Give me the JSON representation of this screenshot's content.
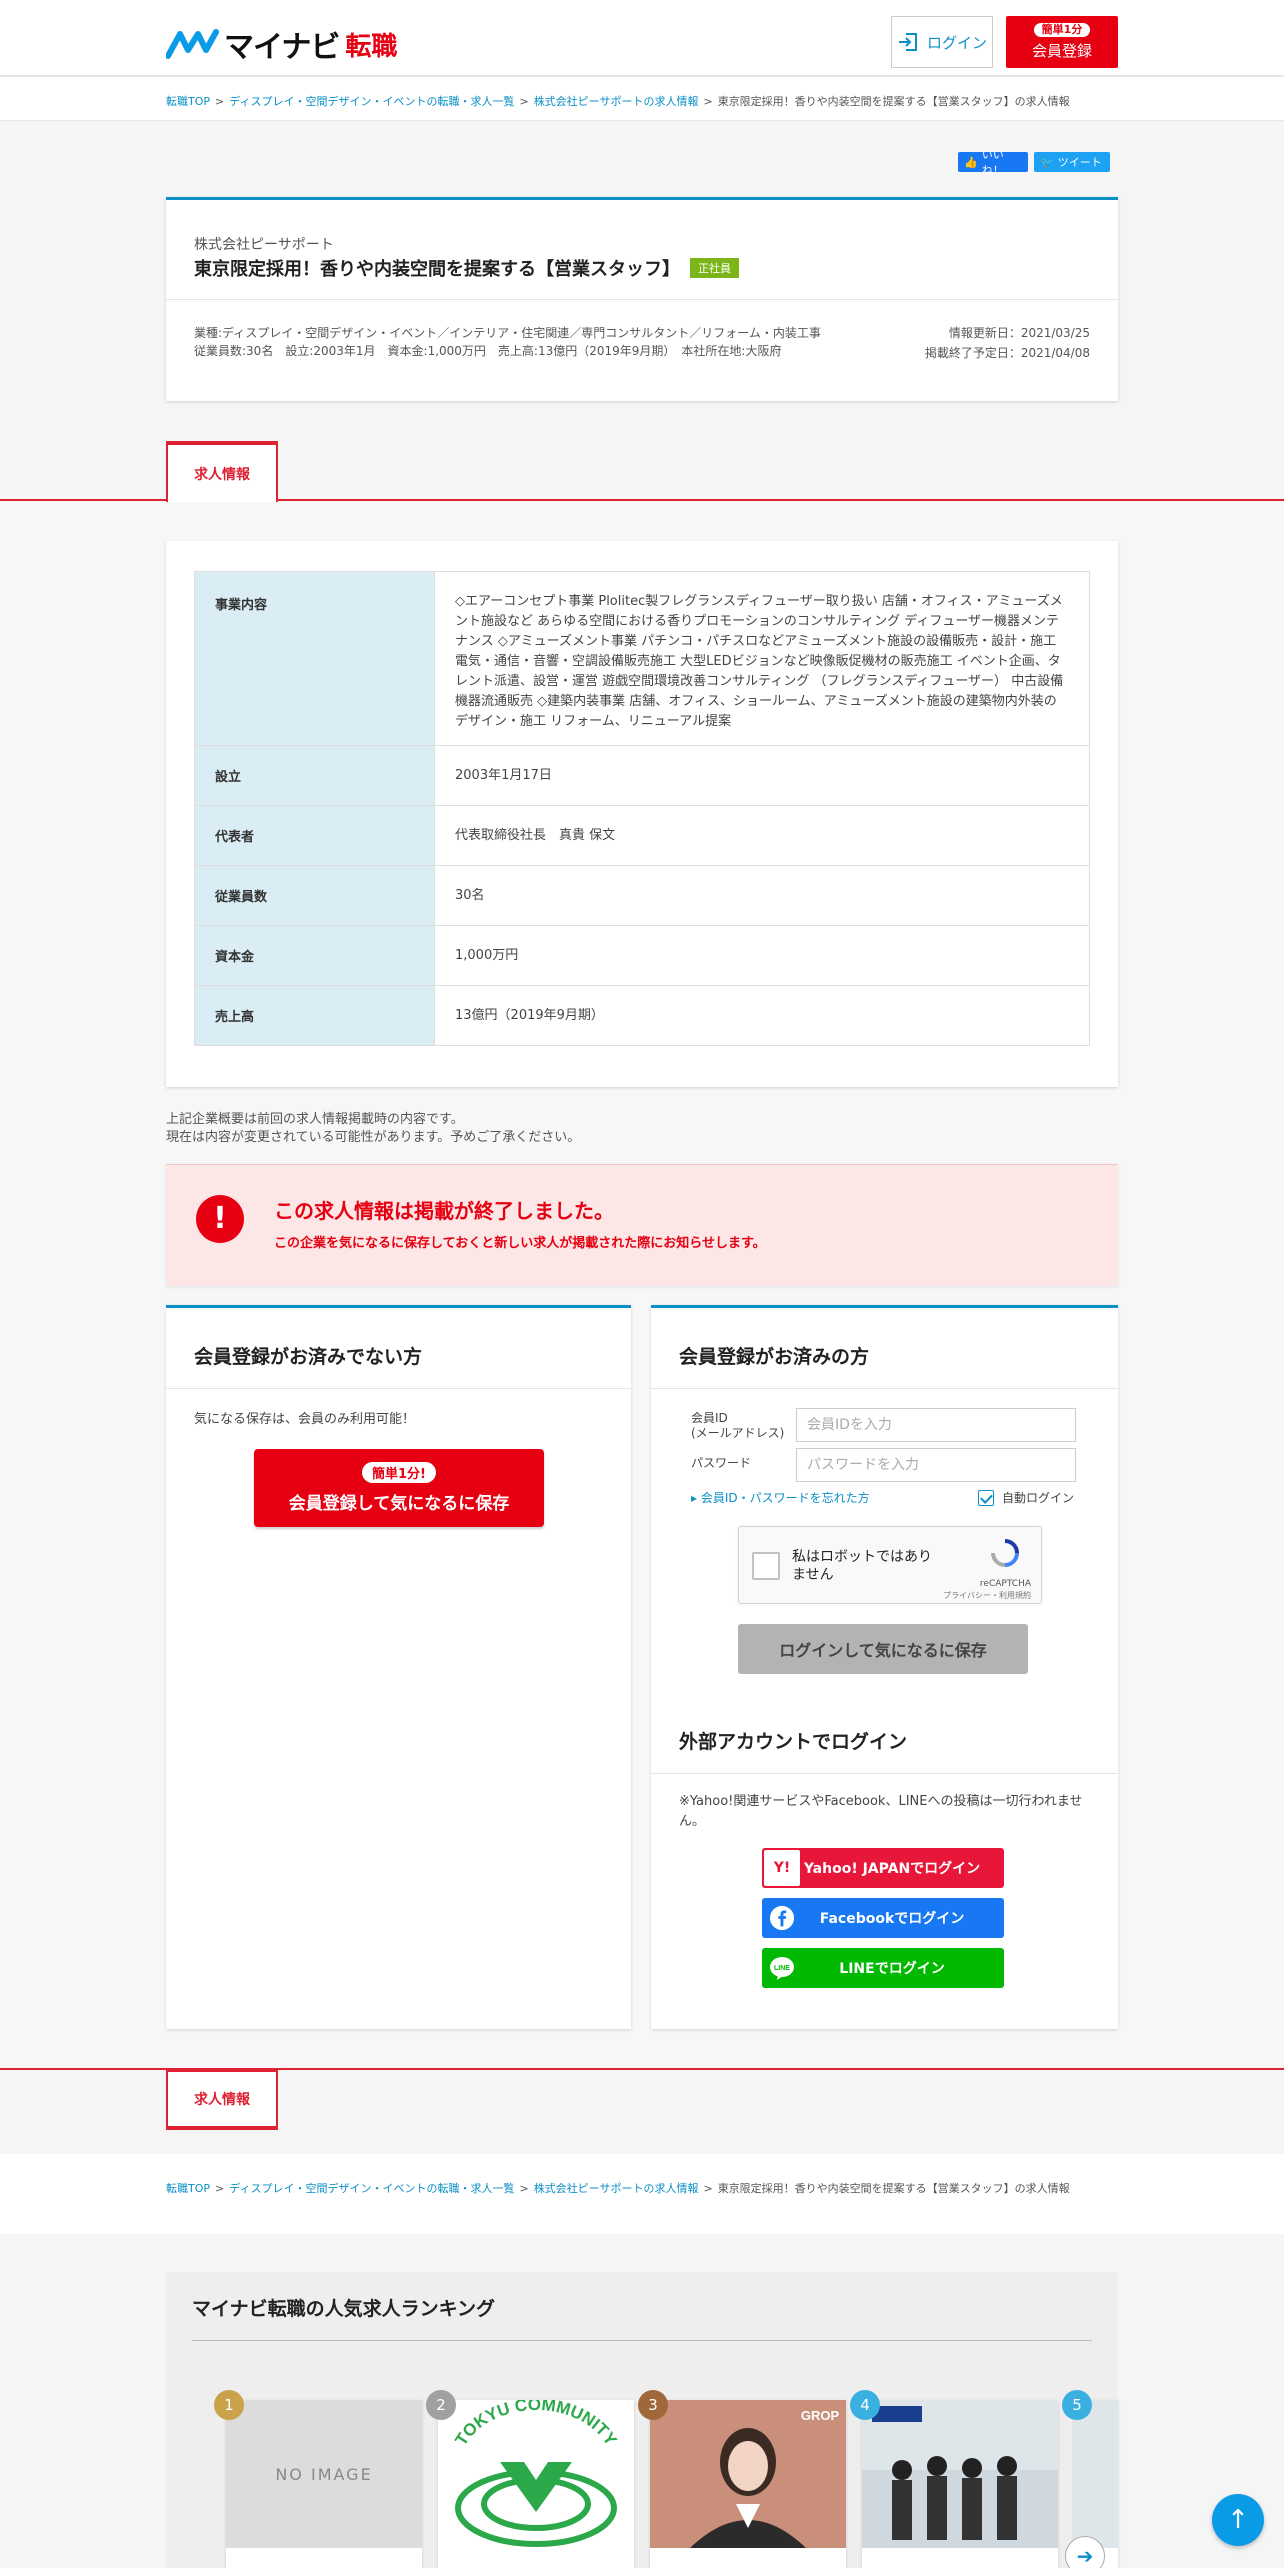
{
  "header": {
    "logo_text": "マイナビ",
    "logo_sub": "転職",
    "login_label": "ログイン",
    "register_pill": "簡単1分",
    "register_label": "会員登録"
  },
  "breadcrumb": {
    "items": [
      "転職TOP",
      "ディスプレイ・空間デザイン・イベントの転職・求人一覧",
      "株式会社ピーサポートの求人情報",
      "東京限定採用！香りや内装空間を提案する【営業スタッフ】の求人情報"
    ],
    "separator": ">"
  },
  "social": {
    "like": "いいね！",
    "tweet": "ツイート"
  },
  "job": {
    "company": "株式会社ピーサポート",
    "title": "東京限定採用！香りや内装空間を提案する【営業スタッフ】",
    "badge": "正社員",
    "industry": "業種:ディスプレイ・空間デザイン・イベント／インテリア・住宅関連／専門コンサルタント／リフォーム・内装工事",
    "summary": "従業員数:30名　設立:2003年1月　資本金:1,000万円　売上高:13億円（2019年9月期）　本社所在地:大阪府",
    "updated": "情報更新日：2021/03/25",
    "end_date": "掲載終了予定日：2021/04/08"
  },
  "tab_label": "求人情報",
  "company_info": {
    "rows": [
      {
        "label": "事業内容",
        "value": "◇エアーコンセプト事業 Plolitec製フレグランスディフューザー取り扱い 店舗・オフィス・アミューズメント施設など あらゆる空間における香りプロモーションのコンサルティング ディフューザー機器メンテナンス ◇アミューズメント事業 パチンコ・パチスロなどアミューズメント施設の設備販売・設計・施工 電気・通信・音響・空調設備販売施工 大型LEDビジョンなど映像販促機材の販売施工 イベント企画、タレント派遣、設営・運営 遊戯空間環境改善コンサルティング （フレグランスディフューザー） 中古設備機器流通販売 ◇建築内装事業 店舗、オフィス、ショールーム、アミューズメント施設の建築物内外装のデザイン・施工 リフォーム、リニューアル提案"
      },
      {
        "label": "設立",
        "value": "2003年1月17日"
      },
      {
        "label": "代表者",
        "value": "代表取締役社長　真貴 保文"
      },
      {
        "label": "従業員数",
        "value": "30名"
      },
      {
        "label": "資本金",
        "value": "1,000万円"
      },
      {
        "label": "売上高",
        "value": "13億円（2019年9月期）"
      }
    ]
  },
  "notes": {
    "line1": "上記企業概要は前回の求人情報掲載時の内容です。",
    "line2": "現在は内容が変更されている可能性があります。予めご了承ください。"
  },
  "ended": {
    "icon": "!",
    "title": "この求人情報は掲載が終了しました。",
    "message": "この企業を気になるに保存しておくと新しい求人が掲載された際にお知らせします。"
  },
  "not_member": {
    "heading": "会員登録がお済みでない方",
    "note": "気になる保存は、会員のみ利用可能！",
    "btn_pill": "簡単1分!",
    "btn_label": "会員登録して気になるに保存"
  },
  "member": {
    "heading": "会員登録がお済みの方",
    "id_label_1": "会員ID",
    "id_label_2": "(メールアドレス)",
    "id_placeholder": "会員IDを入力",
    "pw_label": "パスワード",
    "pw_placeholder": "パスワードを入力",
    "forgot": "▸ 会員ID・パスワードを忘れた方",
    "auto_login": "自動ログイン",
    "captcha_text_1": "私はロボットではあり",
    "captcha_text_2": "ません",
    "captcha_brand": "reCAPTCHA",
    "captcha_sub": "プライバシー・利用規約",
    "login_save": "ログインして気になるに保存"
  },
  "external": {
    "heading": "外部アカウントでログイン",
    "note": "※Yahoo!関連サービスやFacebook、LINEへの投稿は一切行われません。",
    "yahoo": "Yahoo! JAPANでログイン",
    "yahoo_icon": "Y!",
    "facebook": "Facebookでログイン",
    "line": "LINEでログイン",
    "line_icon": "LINE"
  },
  "ranking": {
    "heading": "マイナビ転職の人気求人ランキング",
    "no_image": "NO IMAGE",
    "tokyu_label": "TOKYU COMMUNITY",
    "grop_label": "GROP",
    "items": [
      {
        "rank": "1",
        "color": "#c9a24a"
      },
      {
        "rank": "2",
        "color": "#a0a0a0"
      },
      {
        "rank": "3",
        "color": "#a0683a"
      },
      {
        "rank": "4",
        "color": "#3ab0e0"
      },
      {
        "rank": "5",
        "color": "#3ab0e0"
      }
    ]
  }
}
